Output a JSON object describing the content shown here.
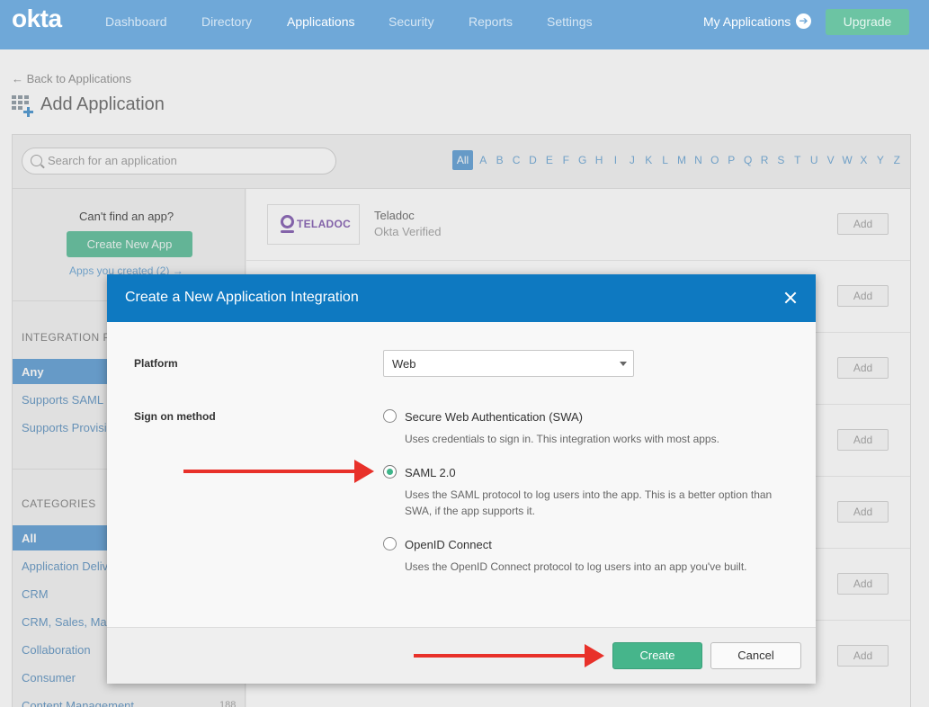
{
  "nav": {
    "logo": "okta",
    "items": [
      "Dashboard",
      "Directory",
      "Applications",
      "Security",
      "Reports",
      "Settings"
    ],
    "active_index": 2,
    "my_applications": "My Applications",
    "upgrade": "Upgrade"
  },
  "header": {
    "back_link": "← Back to Applications",
    "title": "Add Application"
  },
  "catalog": {
    "search_placeholder": "Search for an application",
    "alphabet": [
      "All",
      "A",
      "B",
      "C",
      "D",
      "E",
      "F",
      "G",
      "H",
      "I",
      "J",
      "K",
      "L",
      "M",
      "N",
      "O",
      "P",
      "Q",
      "R",
      "S",
      "T",
      "U",
      "V",
      "W",
      "X",
      "Y",
      "Z"
    ],
    "alphabet_selected": "All",
    "cant_find": "Can't find an app?",
    "create_new_app": "Create New App",
    "apps_created": "Apps you created (2) →",
    "integration_heading": "INTEGRATION PR",
    "integration_items": [
      "Any",
      "Supports SAML",
      "Supports Provisi"
    ],
    "categories_heading": "CATEGORIES",
    "categories": [
      "All",
      "Application Deliv",
      "CRM",
      "CRM, Sales, Mark",
      "Collaboration",
      "Consumer",
      "Content Management"
    ],
    "categories_last_count": "188",
    "app": {
      "logo_text": "TELADOC",
      "name": "Teladoc",
      "verified": "Okta Verified"
    },
    "add_label": "Add"
  },
  "modal": {
    "title": "Create a New Application Integration",
    "platform_label": "Platform",
    "platform_value": "Web",
    "sign_on_label": "Sign on method",
    "options": [
      {
        "label": "Secure Web Authentication (SWA)",
        "desc": "Uses credentials to sign in. This integration works with most apps.",
        "checked": false
      },
      {
        "label": "SAML 2.0",
        "desc": "Uses the SAML protocol to log users into the app. This is a better option than SWA, if the app supports it.",
        "checked": true
      },
      {
        "label": "OpenID Connect",
        "desc": "Uses the OpenID Connect protocol to log users into an app you've built.",
        "checked": false
      }
    ],
    "create": "Create",
    "cancel": "Cancel"
  },
  "colors": {
    "nav_bg": "#6fa8d8",
    "modal_header": "#0e79c1",
    "primary_green": "#46b58b",
    "annotation_red": "#e8312a"
  }
}
